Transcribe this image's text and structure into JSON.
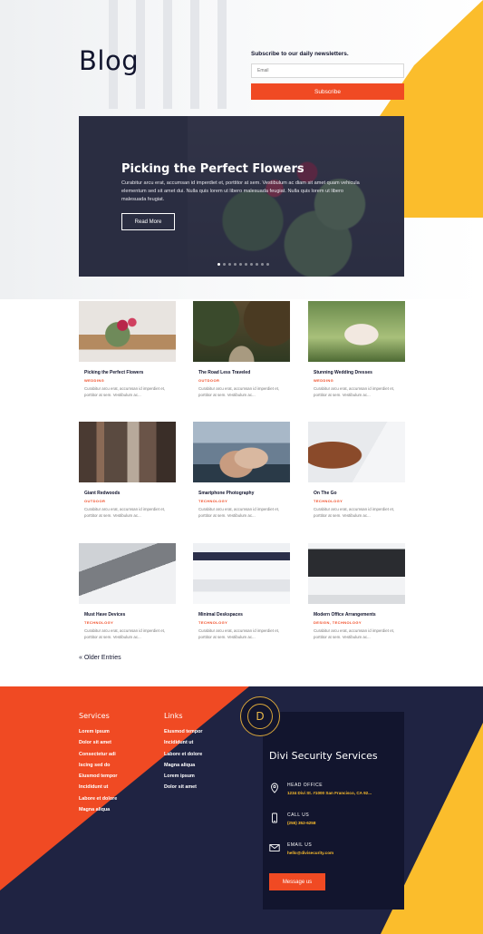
{
  "header": {
    "title": "Blog",
    "newsletter_label": "Subscribe to our daily newsletters.",
    "email_placeholder": "Email",
    "subscribe_label": "Subscribe"
  },
  "slider": {
    "title": "Picking the Perfect Flowers",
    "text": "Curabitur arcu erat, accumsan id imperdiet et, porttitor at sem. Vestibulum ac diam sit amet quam vehicula elementum sed sit amet dui. Nulla quis lorem ut libero malesuada feugiat. Nulla quis lorem ut libero malesuada feugiat.",
    "button": "Read More",
    "dots_count": 10,
    "active_dot": 0
  },
  "posts": [
    {
      "title": "Picking the Perfect Flowers",
      "category": "WEDDING",
      "excerpt": "Curabitur arcu erat, accumsan id imperdiet et, porttitor at sem. Vestibulum ac...",
      "thumb": "flowers"
    },
    {
      "title": "The Road Less Traveled",
      "category": "OUTDOOR",
      "excerpt": "Curabitur arcu erat, accumsan id imperdiet et, porttitor at sem. Vestibulum ac...",
      "thumb": "road"
    },
    {
      "title": "Stunning Wedding Dresses",
      "category": "WEDDING",
      "excerpt": "Curabitur arcu erat, accumsan id imperdiet et, porttitor at sem. Vestibulum ac...",
      "thumb": "dress"
    },
    {
      "title": "Giant Redwoods",
      "category": "OUTDOOR",
      "excerpt": "Curabitur arcu erat, accumsan id imperdiet et, porttitor at sem. Vestibulum ac...",
      "thumb": "redwoods"
    },
    {
      "title": "Smartphone Photography",
      "category": "TECHNOLOGY",
      "excerpt": "Curabitur arcu erat, accumsan id imperdiet et, porttitor at sem. Vestibulum ac...",
      "thumb": "phone"
    },
    {
      "title": "On The Go",
      "category": "TECHNOLOGY",
      "excerpt": "Curabitur arcu erat, accumsan id imperdiet et, porttitor at sem. Vestibulum ac...",
      "thumb": "onthego"
    },
    {
      "title": "Must Have Devices",
      "category": "TECHNOLOGY",
      "excerpt": "Curabitur arcu erat, accumsan id imperdiet et, porttitor at sem. Vestibulum ac...",
      "thumb": "laptop"
    },
    {
      "title": "Minimal Deskspaces",
      "category": "TECHNOLOGY",
      "excerpt": "Curabitur arcu erat, accumsan id imperdiet et, porttitor at sem. Vestibulum ac...",
      "thumb": "keyboard"
    },
    {
      "title": "Modern Office Arrangements",
      "category": "DESIGN, TECHNOLOGY",
      "excerpt": "Curabitur arcu erat, accumsan id imperdiet et, porttitor at sem. Vestibulum ac...",
      "thumb": "office"
    }
  ],
  "pagination": {
    "older": "« Older Entries"
  },
  "footer": {
    "services_heading": "Services",
    "services": [
      "Lorem ipsum",
      "Dolor sit amet",
      "Consectetur adi",
      "Iscing sed do",
      "Eiusmod tempor",
      "Incididunt ut",
      "Labore et dolore",
      "Magna aliqua"
    ],
    "links_heading": "Links",
    "links": [
      "Eiusmod tempor",
      "Incididunt ut",
      "Labore et dolore",
      "Magna aliqua",
      "Lorem ipsum",
      "Dolor sit amet"
    ],
    "badge_letter": "D",
    "card_title": "Divi Security Services",
    "office_label": "HEAD OFFICE",
    "office_value": "1234 Divi St. #1000 San Francisco, CA 92...",
    "call_label": "CALL US",
    "call_value": "(255) 352-6258",
    "email_label": "EMAIL US",
    "email_value": "hello@divisecurity.com",
    "message_button": "Message us"
  },
  "colors": {
    "accent": "#f04a23",
    "yellow": "#fbbd2c",
    "navy": "#12152e"
  }
}
